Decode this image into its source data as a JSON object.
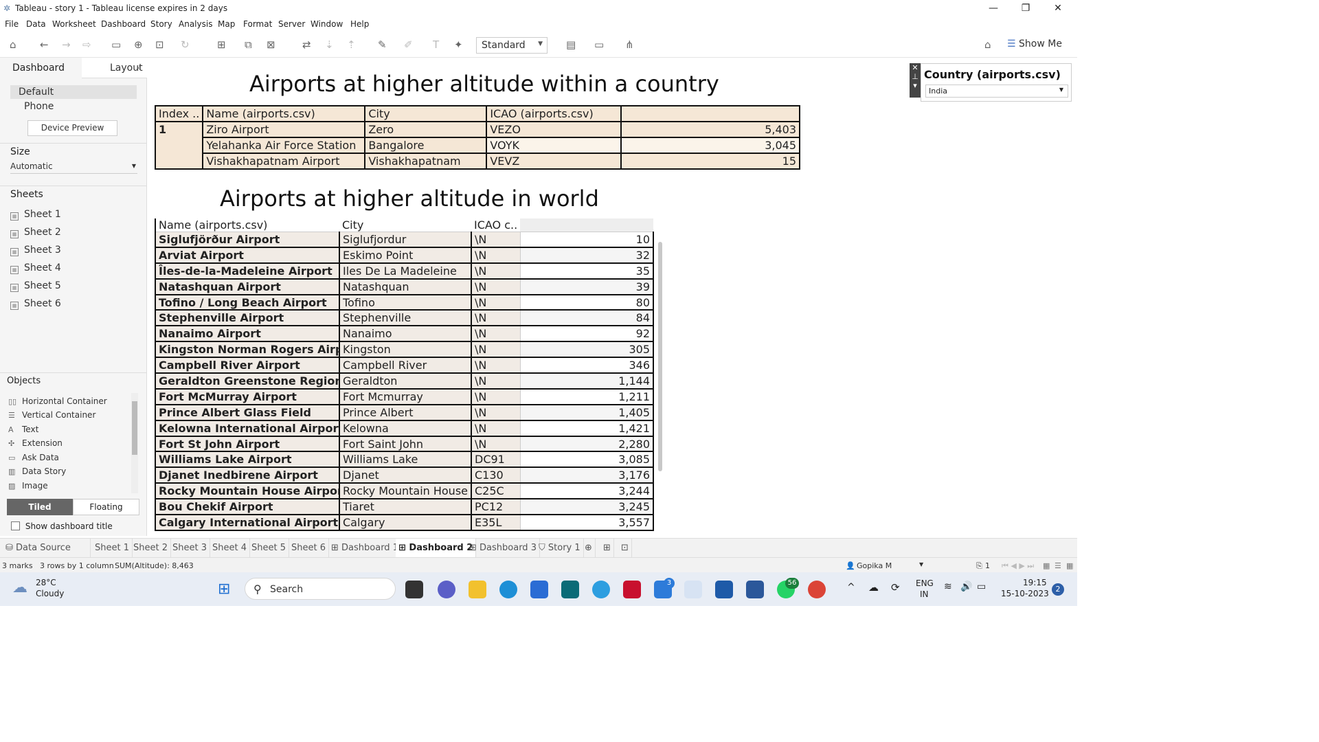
{
  "window": {
    "title": "Tableau - story 1 - Tableau license expires in 2 days",
    "minimize": "—",
    "restore": "❐",
    "close": "✕"
  },
  "menu": [
    "File",
    "Data",
    "Worksheet",
    "Dashboard",
    "Story",
    "Analysis",
    "Map",
    "Format",
    "Server",
    "Window",
    "Help"
  ],
  "toolbar": {
    "fit_select": "Standard",
    "show_me": "Show Me"
  },
  "left_panel": {
    "tab_dashboard": "Dashboard",
    "tab_layout": "Layout",
    "device_default": "Default",
    "device_phone": "Phone",
    "device_preview": "Device Preview",
    "size_heading": "Size",
    "size_value": "Automatic",
    "sheets_heading": "Sheets",
    "sheets": [
      "Sheet 1",
      "Sheet 2",
      "Sheet 3",
      "Sheet 4",
      "Sheet 5",
      "Sheet 6"
    ],
    "objects_heading": "Objects",
    "objects": [
      "Horizontal Container",
      "Vertical Container",
      "Text",
      "Extension",
      "Ask Data",
      "Data Story",
      "Image"
    ],
    "tiled": "Tiled",
    "floating": "Floating",
    "show_title": "Show dashboard title"
  },
  "dashboard": {
    "title1": "Airports at higher altitude within a country",
    "table1": {
      "headers": [
        "Index ..",
        "Name (airports.csv)",
        "City",
        "ICAO (airports.csv)",
        ""
      ],
      "index": "1",
      "rows": [
        {
          "name": "Ziro Airport",
          "city": "Zero",
          "icao": "VEZO",
          "value": "5,403"
        },
        {
          "name": "Yelahanka Air Force Station",
          "city": "Bangalore",
          "icao": "VOYK",
          "value": "3,045"
        },
        {
          "name": "Vishakhapatnam Airport",
          "city": "Vishakhapatnam",
          "icao": "VEVZ",
          "value": "15"
        }
      ]
    },
    "title2": "Airports at higher altitude in world",
    "table2": {
      "headers": [
        "Name (airports.csv)",
        "City",
        "ICAO c..",
        ""
      ],
      "rows": [
        {
          "name": "Siglufjörður Airport",
          "city": "Siglufjordur",
          "icao": "\\N",
          "value": "10"
        },
        {
          "name": "Arviat Airport",
          "city": "Eskimo Point",
          "icao": "\\N",
          "value": "32"
        },
        {
          "name": "Îles-de-la-Madeleine Airport",
          "city": "Iles De La Madeleine",
          "icao": "\\N",
          "value": "35"
        },
        {
          "name": "Natashquan Airport",
          "city": "Natashquan",
          "icao": "\\N",
          "value": "39"
        },
        {
          "name": "Tofino / Long Beach Airport",
          "city": "Tofino",
          "icao": "\\N",
          "value": "80"
        },
        {
          "name": "Stephenville Airport",
          "city": "Stephenville",
          "icao": "\\N",
          "value": "84"
        },
        {
          "name": "Nanaimo Airport",
          "city": "Nanaimo",
          "icao": "\\N",
          "value": "92"
        },
        {
          "name": "Kingston Norman Rogers Airport",
          "city": "Kingston",
          "icao": "\\N",
          "value": "305"
        },
        {
          "name": "Campbell River Airport",
          "city": "Campbell River",
          "icao": "\\N",
          "value": "346"
        },
        {
          "name": "Geraldton Greenstone Regional ..",
          "city": "Geraldton",
          "icao": "\\N",
          "value": "1,144"
        },
        {
          "name": "Fort McMurray Airport",
          "city": "Fort Mcmurray",
          "icao": "\\N",
          "value": "1,211"
        },
        {
          "name": "Prince Albert Glass Field",
          "city": "Prince Albert",
          "icao": "\\N",
          "value": "1,405"
        },
        {
          "name": "Kelowna International Airport",
          "city": "Kelowna",
          "icao": "\\N",
          "value": "1,421"
        },
        {
          "name": "Fort St John Airport",
          "city": "Fort Saint John",
          "icao": "\\N",
          "value": "2,280"
        },
        {
          "name": "Williams Lake Airport",
          "city": "Williams Lake",
          "icao": "DC91",
          "value": "3,085"
        },
        {
          "name": "Djanet Inedbirene Airport",
          "city": "Djanet",
          "icao": "C130",
          "value": "3,176"
        },
        {
          "name": "Rocky Mountain House Airport",
          "city": "Rocky Mountain House",
          "icao": "C25C",
          "value": "3,244"
        },
        {
          "name": "Bou Chekif Airport",
          "city": "Tiaret",
          "icao": "PC12",
          "value": "3,245"
        },
        {
          "name": "Calgary International Airport",
          "city": "Calgary",
          "icao": "E35L",
          "value": "3,557"
        }
      ]
    },
    "filter": {
      "title": "Country (airports.csv)",
      "value": "India"
    }
  },
  "sheet_tabs": [
    "Data Source",
    "Sheet 1",
    "Sheet 2",
    "Sheet 3",
    "Sheet 4",
    "Sheet 5",
    "Sheet 6",
    "Dashboard 1",
    "Dashboard 2",
    "Dashboard 3",
    "Story 1"
  ],
  "active_tab": "Dashboard 2",
  "status": {
    "marks": "3 marks",
    "rows": "3 rows by 1 column",
    "sum": "SUM(Altitude): 8,463",
    "user": "Gopika M",
    "pages": "1"
  },
  "taskbar": {
    "weather_temp": "28°C",
    "weather_desc": "Cloudy",
    "search": "Search",
    "badge_todo": "3",
    "badge_whatsapp": "56",
    "lang1": "ENG",
    "lang2": "IN",
    "time": "19:15",
    "date": "15-10-2023",
    "notif": "2"
  },
  "colors": {
    "header_fill": "#f5e7d6",
    "row_fill": "#f1ebe5",
    "active_tab_text": "#222222"
  }
}
